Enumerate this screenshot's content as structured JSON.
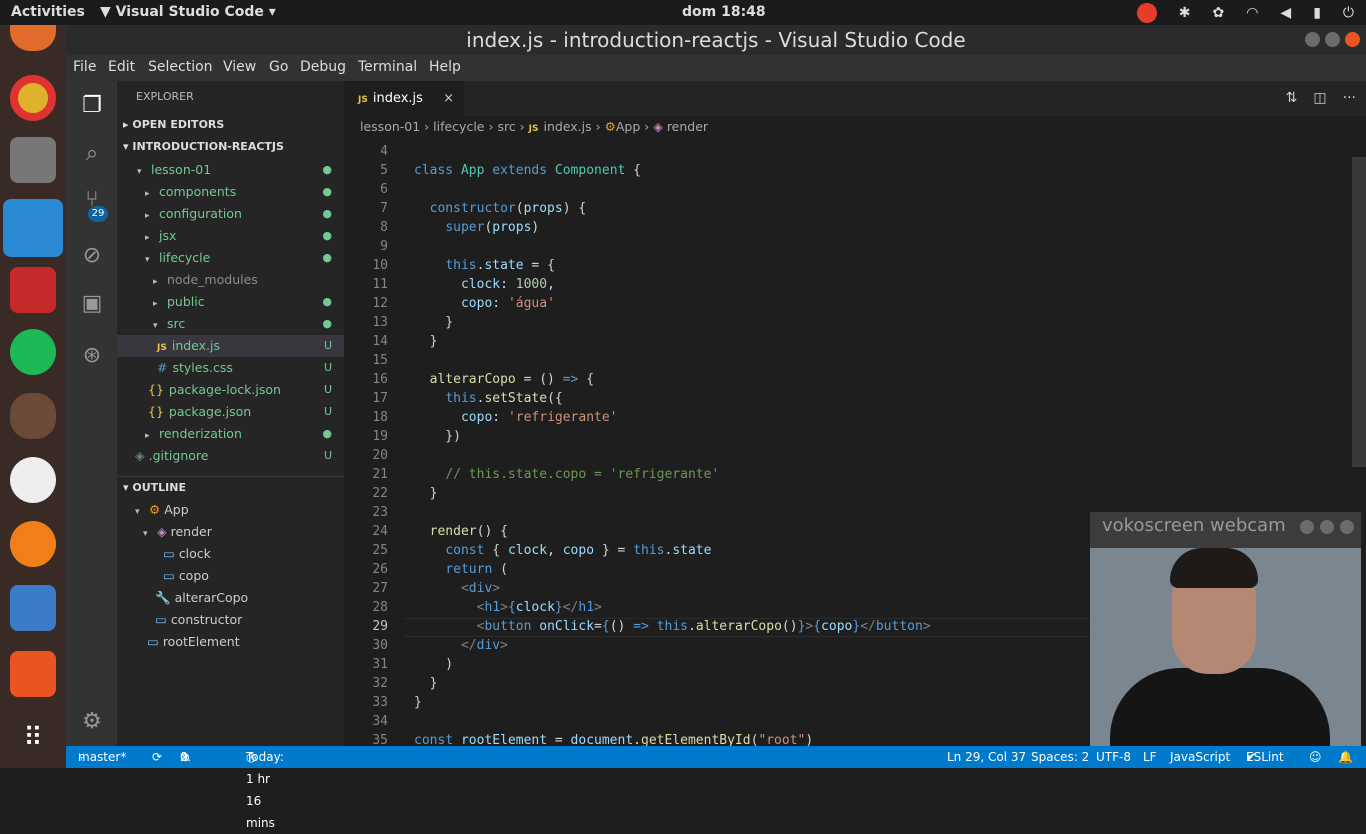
{
  "topbar": {
    "activities": "Activities",
    "app_menu": "Visual Studio Code",
    "clock": "dom 18:48"
  },
  "window": {
    "title": "index.js - introduction-reactjs - Visual Studio Code"
  },
  "menu": [
    "File",
    "Edit",
    "Selection",
    "View",
    "Go",
    "Debug",
    "Terminal",
    "Help"
  ],
  "activity": {
    "scm_badge": "29"
  },
  "sidebar": {
    "header": "EXPLORER",
    "open_editors": "OPEN EDITORS",
    "project": "INTRODUCTION-REACTJS",
    "tree": [
      {
        "label": "lesson-01",
        "status": "●"
      },
      {
        "label": "components",
        "status": "●"
      },
      {
        "label": "configuration",
        "status": "●"
      },
      {
        "label": "jsx",
        "status": "●"
      },
      {
        "label": "lifecycle",
        "status": "●"
      },
      {
        "label": "node_modules",
        "status": ""
      },
      {
        "label": "public",
        "status": "●"
      },
      {
        "label": "src",
        "status": "●"
      },
      {
        "label": "index.js",
        "status": "U"
      },
      {
        "label": "styles.css",
        "status": "U"
      },
      {
        "label": "package-lock.json",
        "status": "U"
      },
      {
        "label": "package.json",
        "status": "U"
      },
      {
        "label": "renderization",
        "status": "●"
      },
      {
        "label": ".gitignore",
        "status": "U"
      }
    ],
    "outline_title": "OUTLINE",
    "outline": [
      {
        "label": "App"
      },
      {
        "label": "render"
      },
      {
        "label": "clock"
      },
      {
        "label": "copo"
      },
      {
        "label": "alterarCopo"
      },
      {
        "label": "constructor"
      },
      {
        "label": "rootElement"
      }
    ]
  },
  "tab": {
    "name": "index.js",
    "close": "×"
  },
  "breadcrumb": [
    "lesson-01",
    "lifecycle",
    "src",
    "index.js",
    "App",
    "render"
  ],
  "editor": {
    "line_numbers": [
      "4",
      "5",
      "6",
      "7",
      "8",
      "9",
      "10",
      "11",
      "12",
      "13",
      "14",
      "15",
      "16",
      "17",
      "18",
      "19",
      "20",
      "21",
      "22",
      "23",
      "24",
      "25",
      "26",
      "27",
      "28",
      "29",
      "30",
      "31",
      "32",
      "33",
      "34",
      "35"
    ],
    "current_line": "29"
  },
  "status": {
    "branch": "master*",
    "errors": "0",
    "warnings": "0",
    "time": "Today: 1 hr 16 mins",
    "position": "Ln 29, Col 37",
    "spaces": "Spaces: 2",
    "encoding": "UTF-8",
    "eol": "LF",
    "language": "JavaScript",
    "eslint": "ESLint"
  },
  "webcam": {
    "title": "vokoscreen webcam"
  }
}
